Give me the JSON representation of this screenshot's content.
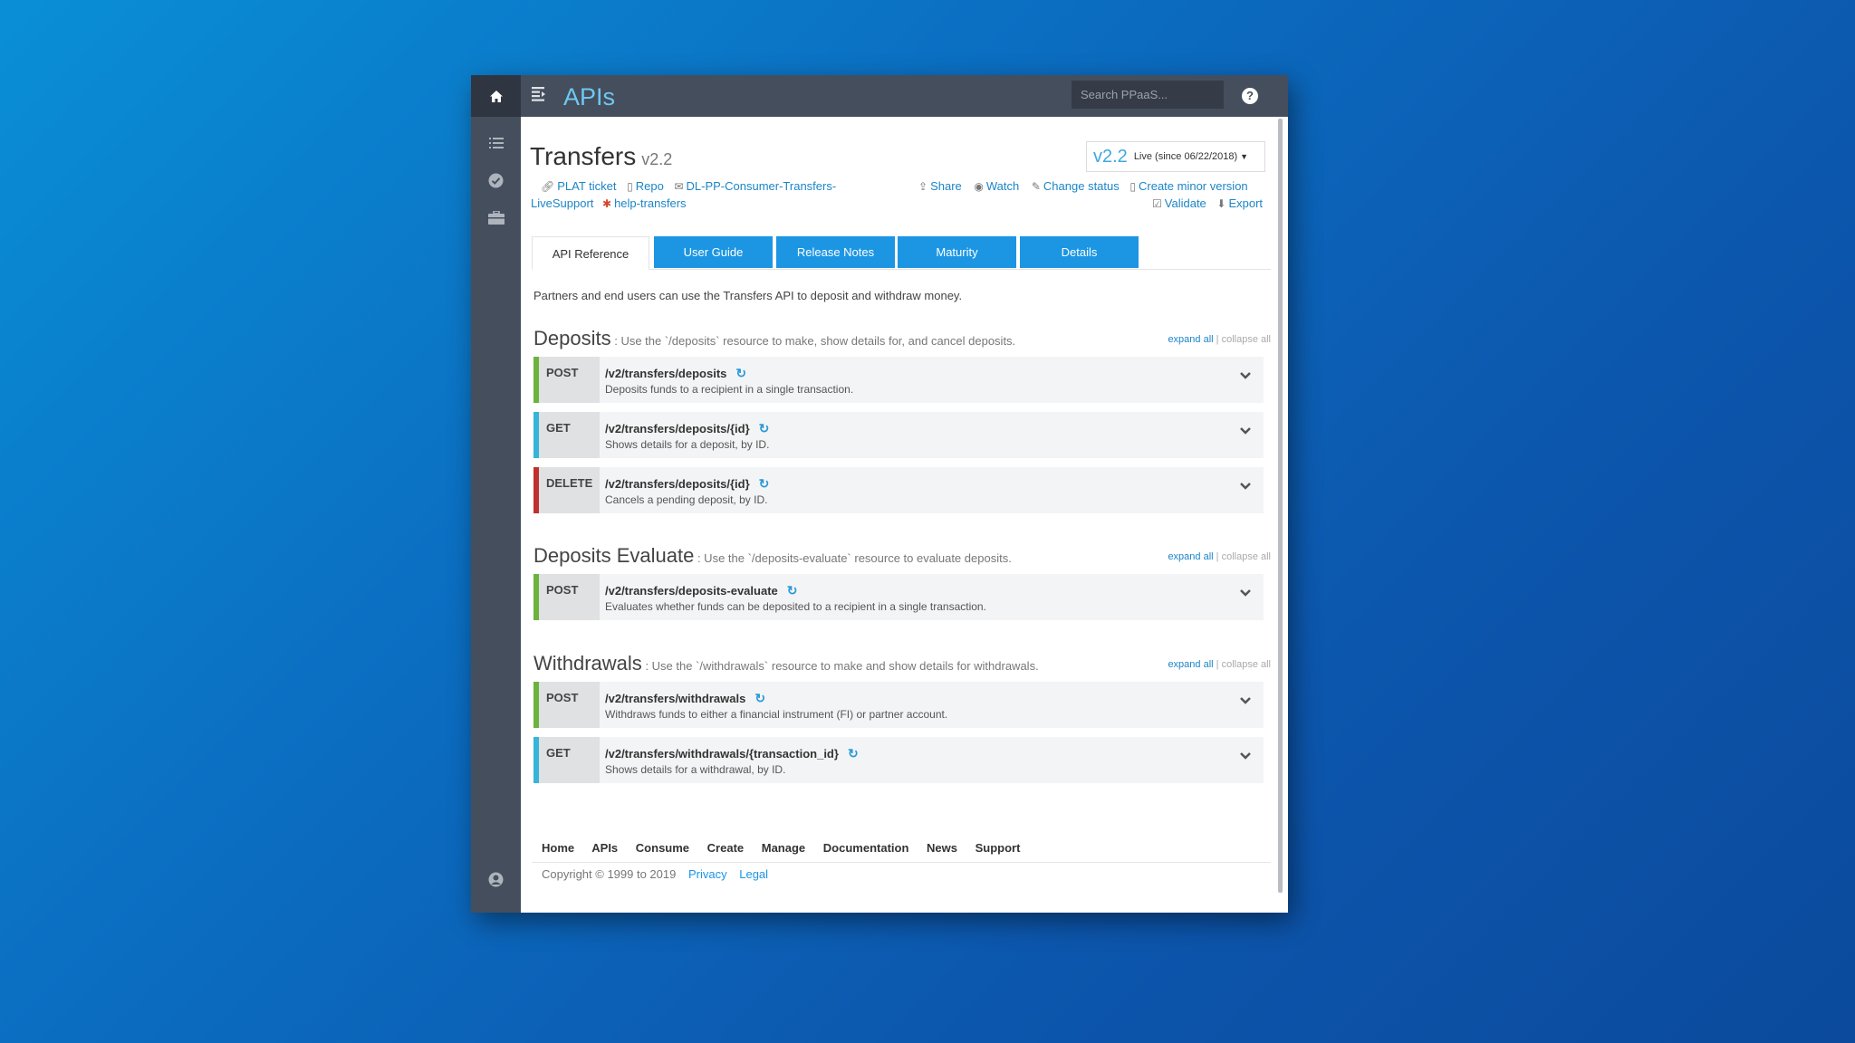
{
  "app": {
    "title": "APIs",
    "search_placeholder": "Search PPaaS..."
  },
  "api": {
    "name": "Transfers",
    "version": "v2.2",
    "version_selector": {
      "version": "v2.2",
      "status": "Live (since 06/22/2018)"
    },
    "links_left": [
      "PLAT ticket",
      "Repo",
      "DL-PP-Consumer-Transfers-",
      "LiveSupport",
      "help-transfers"
    ],
    "actions": [
      "Share",
      "Watch",
      "Change status",
      "Create minor version",
      "Validate",
      "Export"
    ],
    "description": "Partners and end users can use the Transfers API to deposit and withdraw money."
  },
  "tabs": [
    "API Reference",
    "User Guide",
    "Release Notes",
    "Maturity",
    "Details"
  ],
  "expand_all": "expand all",
  "collapse_all": "collapse all",
  "separator": "|",
  "sections": [
    {
      "name": "Deposits",
      "desc": ": Use the `/deposits` resource to make, show details for, and cancel deposits.",
      "ops": [
        {
          "method": "POST",
          "path": "/v2/transfers/deposits",
          "summary": "Deposits funds to a recipient in a single transaction."
        },
        {
          "method": "GET",
          "path": "/v2/transfers/deposits/{id}",
          "summary": "Shows details for a deposit, by ID."
        },
        {
          "method": "DELETE",
          "path": "/v2/transfers/deposits/{id}",
          "summary": "Cancels a pending deposit, by ID."
        }
      ]
    },
    {
      "name": "Deposits Evaluate",
      "desc": ": Use the `/deposits-evaluate` resource to evaluate deposits.",
      "ops": [
        {
          "method": "POST",
          "path": "/v2/transfers/deposits-evaluate",
          "summary": "Evaluates whether funds can be deposited to a recipient in a single transaction."
        }
      ]
    },
    {
      "name": "Withdrawals",
      "desc": ": Use the `/withdrawals` resource to make and show details for withdrawals.",
      "ops": [
        {
          "method": "POST",
          "path": "/v2/transfers/withdrawals",
          "summary": "Withdraws funds to either a financial instrument (FI) or partner account."
        },
        {
          "method": "GET",
          "path": "/v2/transfers/withdrawals/{transaction_id}",
          "summary": "Shows details for a withdrawal, by ID."
        }
      ]
    }
  ],
  "footer": {
    "nav": [
      "Home",
      "APIs",
      "Consume",
      "Create",
      "Manage",
      "Documentation",
      "News",
      "Support"
    ],
    "copyright": "Copyright © 1999 to 2019",
    "privacy": "Privacy",
    "legal": "Legal"
  },
  "colors": {
    "post": "#6cb33e",
    "get": "#35b5d8",
    "delete": "#c0302c",
    "accent": "#1c96e3"
  }
}
